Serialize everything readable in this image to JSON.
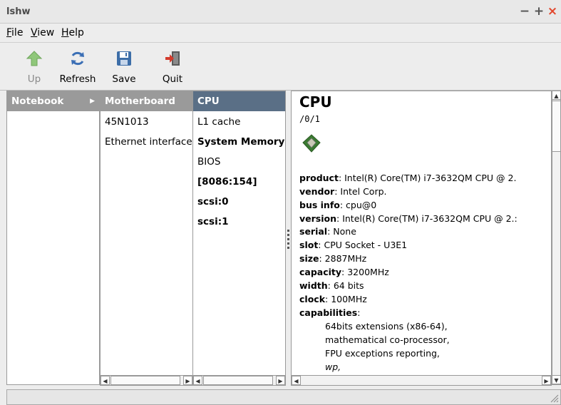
{
  "window": {
    "title": "lshw"
  },
  "menu": [
    "File",
    "View",
    "Help"
  ],
  "toolbar": [
    {
      "label": "Up",
      "icon": "up-arrow-icon",
      "enabled": false
    },
    {
      "label": "Refresh",
      "icon": "refresh-icon",
      "enabled": true
    },
    {
      "label": "Save",
      "icon": "save-icon",
      "enabled": true
    },
    {
      "label": "Quit",
      "icon": "quit-icon",
      "enabled": true
    }
  ],
  "columns": [
    {
      "items": [
        {
          "label": "Notebook",
          "selected": true,
          "bold": true
        }
      ]
    },
    {
      "items": [
        {
          "label": "Motherboard",
          "selected": true,
          "bold": true
        },
        {
          "label": "45N1013"
        },
        {
          "label": "Ethernet interface"
        }
      ]
    },
    {
      "items": [
        {
          "label": "CPU",
          "selected": true,
          "bold": true
        },
        {
          "label": "L1 cache"
        },
        {
          "label": "System Memory",
          "bold": true
        },
        {
          "label": "BIOS"
        },
        {
          "label": "[8086:154]",
          "bold": true
        },
        {
          "label": "scsi:0",
          "bold": true
        },
        {
          "label": "scsi:1",
          "bold": true
        }
      ]
    }
  ],
  "detail": {
    "title": "CPU",
    "path": "/0/1",
    "chip_icon": "cpu-chip-icon",
    "fields": [
      {
        "key": "product",
        "value": "Intel(R) Core(TM) i7-3632QM CPU @ 2."
      },
      {
        "key": "vendor",
        "value": "Intel Corp."
      },
      {
        "key": "bus info",
        "value": "cpu@0"
      },
      {
        "key": "version",
        "value": "Intel(R) Core(TM) i7-3632QM CPU @ 2.:"
      },
      {
        "key": "serial",
        "value": "None"
      },
      {
        "key": "slot",
        "value": "CPU Socket - U3E1"
      },
      {
        "key": "size",
        "value": "2887MHz"
      },
      {
        "key": "capacity",
        "value": "3200MHz"
      },
      {
        "key": "width",
        "value": "64 bits"
      },
      {
        "key": "clock",
        "value": "100MHz"
      },
      {
        "key": "capabilities",
        "value": ""
      }
    ],
    "capabilities": [
      {
        "text": "64bits extensions (x86-64),",
        "italic": false
      },
      {
        "text": "mathematical co-processor,",
        "italic": false
      },
      {
        "text": "FPU exceptions reporting,",
        "italic": false
      },
      {
        "text": "wp,",
        "italic": true
      }
    ]
  },
  "colors": {
    "selected_header": "#5a6f86",
    "unfocused_header": "#9a9a9a",
    "close_button": "#e2462c"
  },
  "status": ""
}
